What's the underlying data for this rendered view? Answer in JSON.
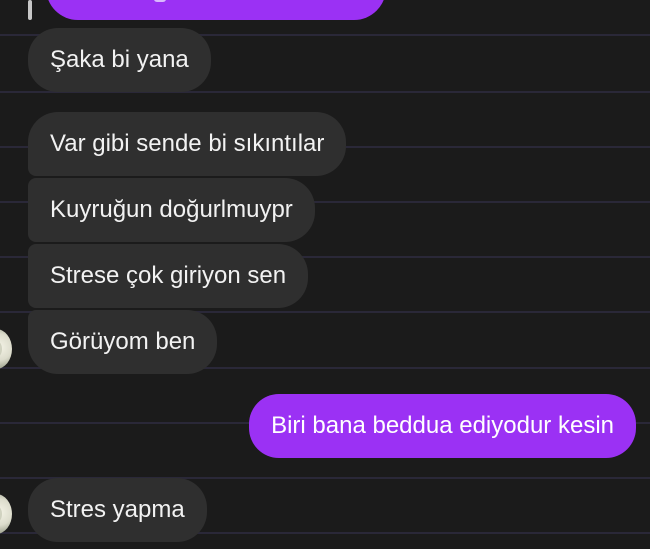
{
  "colors": {
    "background": "#1b1b1b",
    "incoming_bubble": "#2f2f2f",
    "outgoing_bubble": "#9b31f4",
    "separator": "#2a2838"
  },
  "messages": [
    {
      "direction": "incoming",
      "text": "Şaka bi yana"
    },
    {
      "direction": "incoming",
      "text": "Var gibi sende bi sıkıntılar"
    },
    {
      "direction": "incoming",
      "text": "Kuyruğun doğurlmuypr"
    },
    {
      "direction": "incoming",
      "text": "Strese çok giriyon sen"
    },
    {
      "direction": "incoming",
      "text": "Görüyom ben"
    },
    {
      "direction": "outgoing",
      "text": "Biri bana beddua ediyodur kesin"
    },
    {
      "direction": "incoming",
      "text": "Stres yapma"
    }
  ],
  "icons": {
    "avatar": "avatar-icon"
  }
}
